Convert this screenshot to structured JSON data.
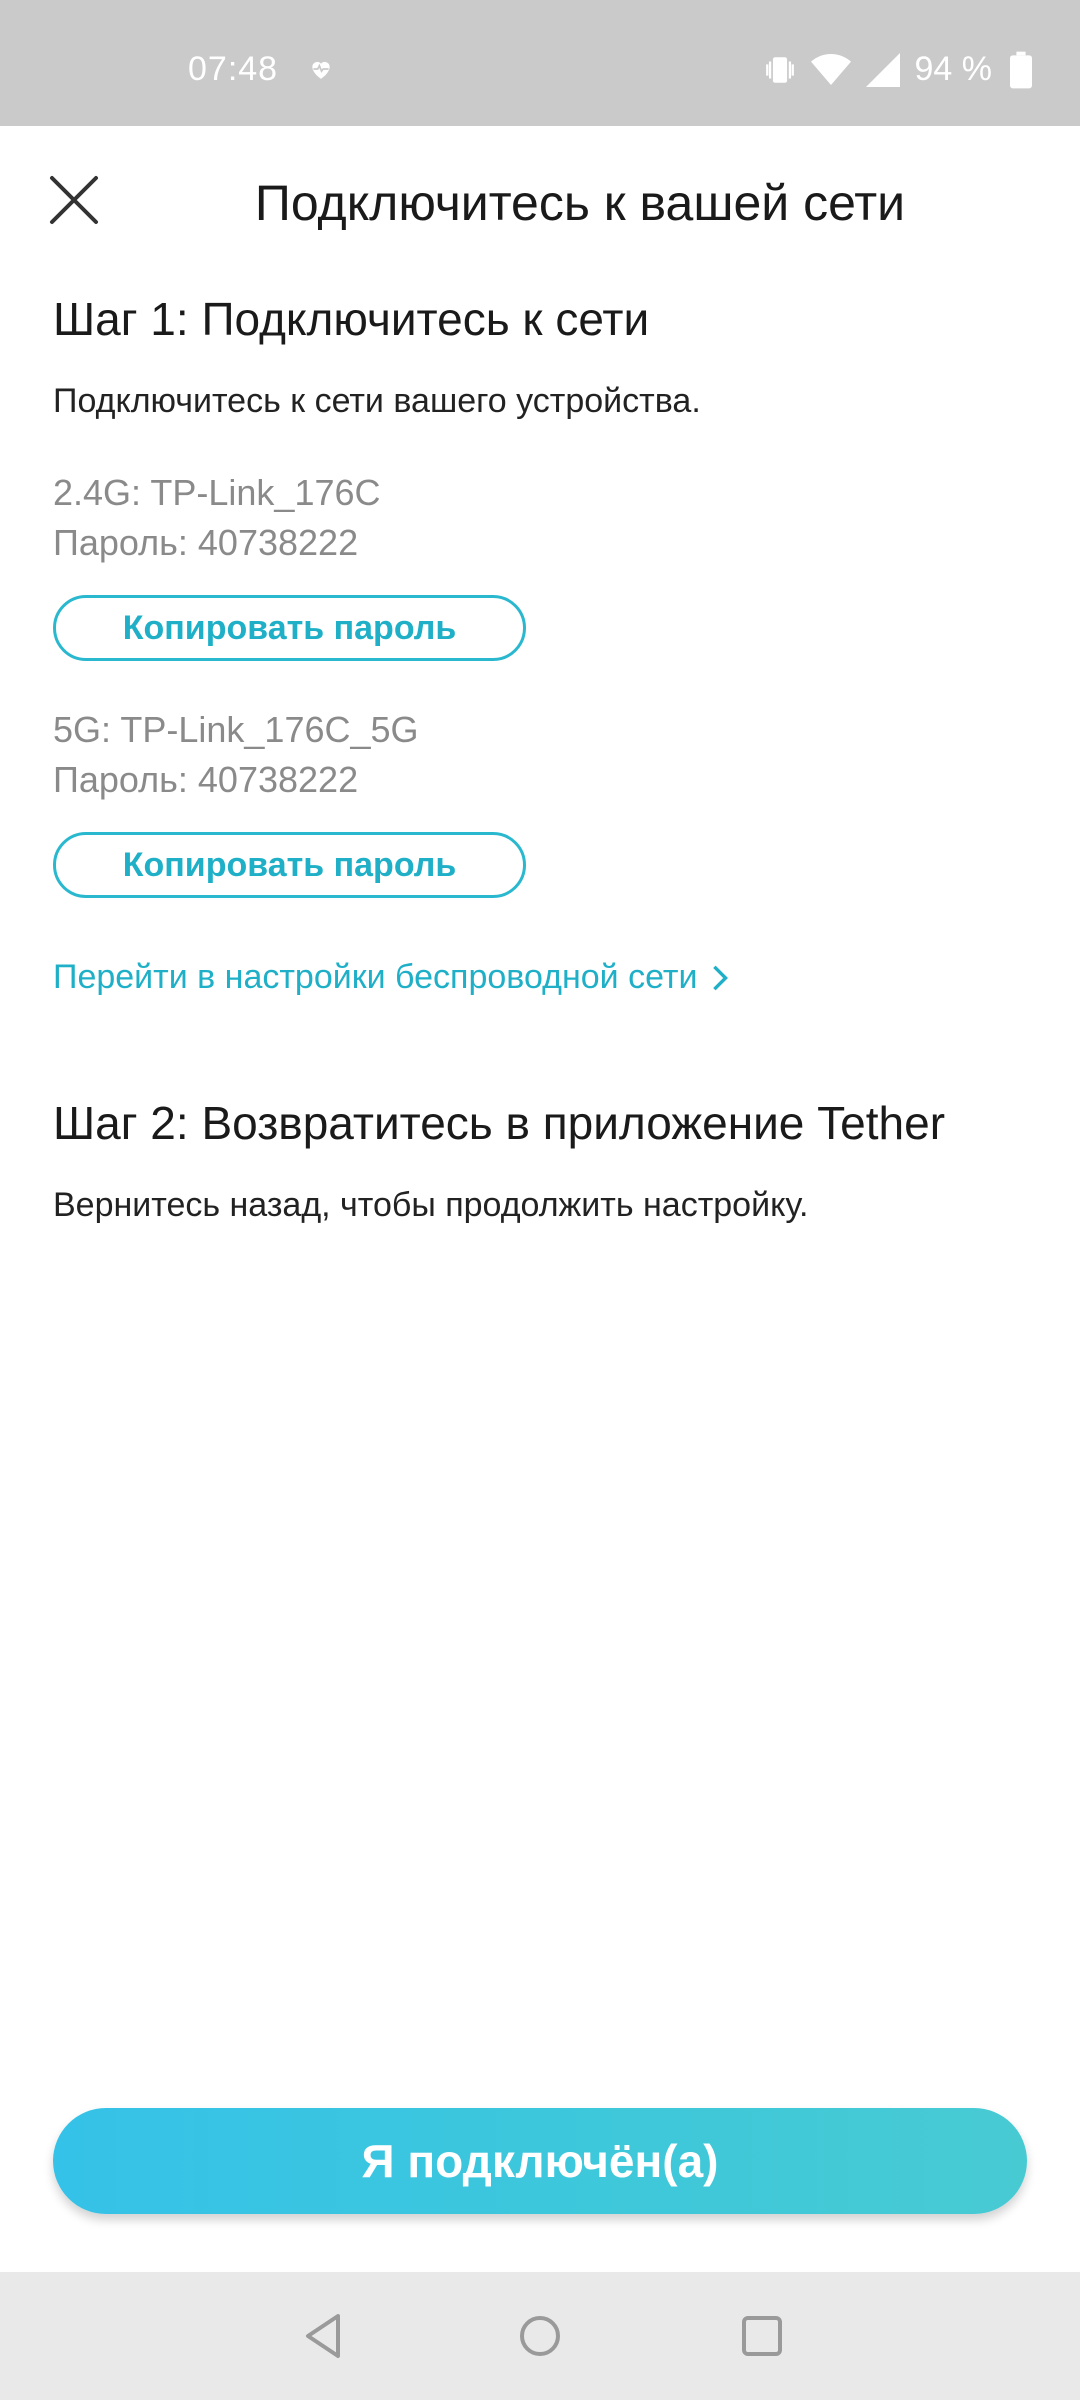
{
  "status_bar": {
    "time": "07:48",
    "battery_text": "94 %",
    "icons": [
      "heart-icon",
      "vibrate-icon",
      "wifi-icon",
      "signal-icon",
      "battery-icon"
    ]
  },
  "header": {
    "title": "Подключитесь к вашей сети",
    "close_icon": "close-icon"
  },
  "step1": {
    "heading": "Шаг 1: Подключитесь к сети",
    "description": "Подключитесь к сети вашего устройства.",
    "networks": [
      {
        "ssid": "2.4G: TP-Link_176C",
        "password": "Пароль: 40738222",
        "copy_label": "Копировать пароль"
      },
      {
        "ssid": "5G: TP-Link_176C_5G",
        "password": "Пароль: 40738222",
        "copy_label": "Копировать пароль"
      }
    ],
    "settings_link": "Перейти в настройки беспроводной сети"
  },
  "step2": {
    "heading": "Шаг 2: Возвратитесь в приложение Tether",
    "description": "Вернитесь назад, чтобы продолжить настройку."
  },
  "footer": {
    "connected_button": "Я подключён(а)"
  },
  "nav_bar": {
    "icons": [
      "back-icon",
      "home-icon",
      "recents-icon"
    ]
  },
  "colors": {
    "accent": "#1fb0c8",
    "primary_gradient_start": "#35c2e8",
    "primary_gradient_end": "#48cad3",
    "status_bar": "#cacaca",
    "nav_bar": "#e9e9e9"
  }
}
